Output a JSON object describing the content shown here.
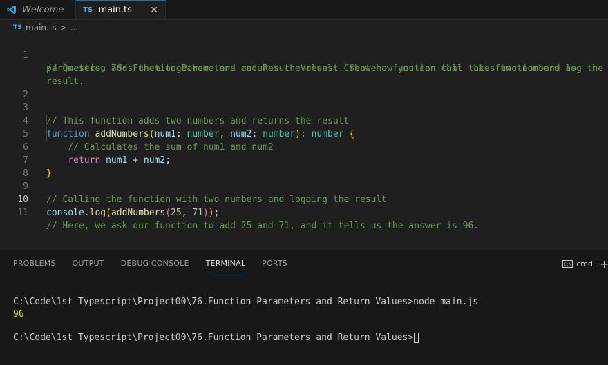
{
  "tabs": [
    {
      "label": "Welcome"
    },
    {
      "badge": "TS",
      "label": "main.ts",
      "close": "✕"
    }
  ],
  "breadcrumb": {
    "badge": "TS",
    "file": "main.ts",
    "sep": ">",
    "rest": "..."
  },
  "editor": {
    "current_line": "10",
    "line_numbers": [
      "1",
      "2",
      "3",
      "4",
      "5",
      "6",
      "7",
      "8",
      "9",
      "10",
      "11"
    ],
    "tokens": {
      "l1a": "// Question 76: Function Parameters and Return Values: Create a function that takes two numbers as",
      "l1b": "parameters, adds them together, and returns the result. Show how you can call this function and log the",
      "l1c": "result.",
      "l3": "// This function adds two numbers and returns the result",
      "function_kw": "function",
      "fn_name": "addNumbers",
      "paren_open": "(",
      "param1": "num1",
      "colon": ":",
      "type_number": "number",
      "comma": ",",
      "param2": "num2",
      "paren_close": ")",
      "brace_open": "{",
      "brace_close": "}",
      "l5": "// Calculates the sum of num1 and num2",
      "return_kw": "return",
      "plus": "+",
      "semi": ";",
      "l9": "// Calling the function with two numbers and logging the result",
      "console": "console",
      "dot": ".",
      "log": "log",
      "arg1": "25",
      "arg2": "71",
      "l11": "// Here, we ask our function to add 25 and 71, and it tells us the answer is 96."
    }
  },
  "panel": {
    "tabs": [
      "PROBLEMS",
      "OUTPUT",
      "DEBUG CONSOLE",
      "TERMINAL",
      "PORTS"
    ],
    "active_tab": "TERMINAL",
    "shell_label": "cmd",
    "shell_icon_text": "C:\\",
    "plus": "+",
    "terminal": {
      "line1": "C:\\Code\\1st Typescript\\Project00\\76.Function Parameters and Return Values>node main.js",
      "output": "96",
      "prompt": "C:\\Code\\1st Typescript\\Project00\\76.Function Parameters and Return Values>"
    }
  },
  "colors": {
    "accent": "#0078d4",
    "comment": "#6a9955",
    "keyword": "#569cd6",
    "function": "#dcdcaa",
    "type": "#4ec9b0",
    "number": "#b5cea8"
  }
}
